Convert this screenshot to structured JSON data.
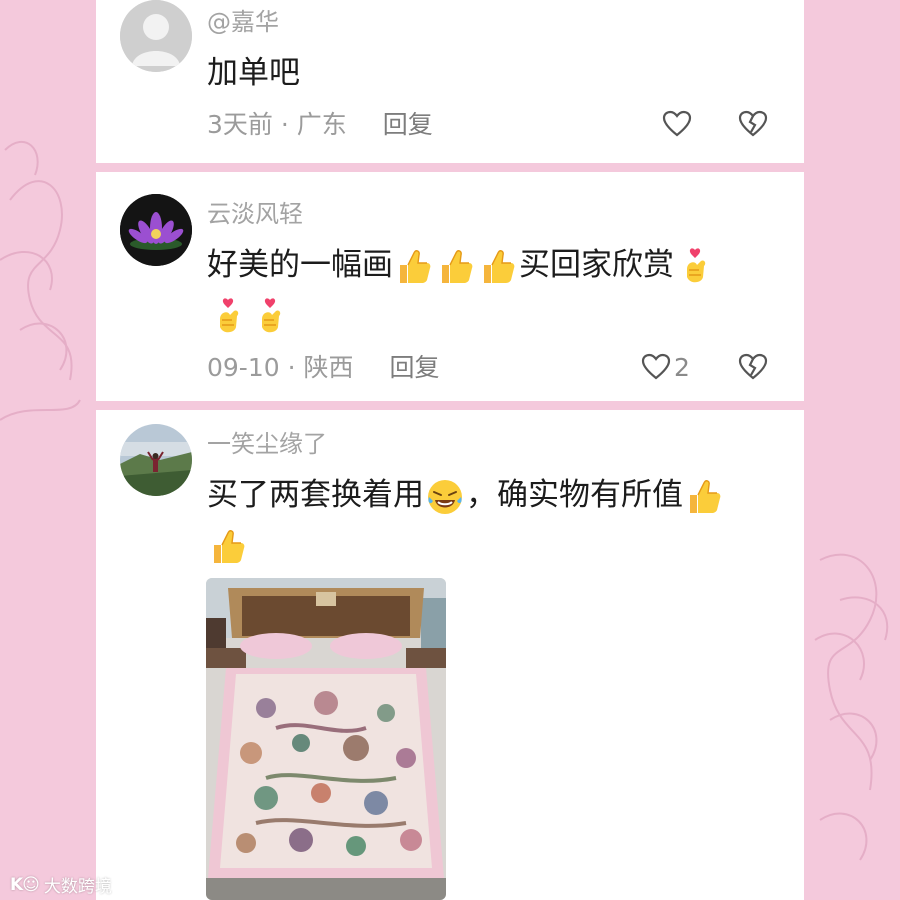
{
  "comments": [
    {
      "username": "@嘉华",
      "text": "加单吧",
      "time": "3天前",
      "location": "广东",
      "reply_label": "回复",
      "likes": ""
    },
    {
      "username": "云淡风轻",
      "text_main": "好美的一幅画",
      "text_tail": "买回家欣赏",
      "time": "09-10",
      "location": "陕西",
      "reply_label": "回复",
      "likes": "2"
    },
    {
      "username": "一笑尘缘了",
      "text_a": "买了两套换着用",
      "text_b": "，确实物有所值",
      "has_photo": true
    }
  ],
  "separator": "·",
  "watermark": {
    "logo": "K☺",
    "text": "大数跨境"
  },
  "colors": {
    "background": "#f4c9dc",
    "card": "#ffffff",
    "meta_text": "#9b9b9b"
  },
  "icons": {
    "like": "heart-outline-icon",
    "dislike": "broken-heart-icon",
    "thumbs_up": "thumbs-up-emoji",
    "finger_heart": "finger-heart-emoji",
    "laugh": "laughing-crying-emoji"
  }
}
